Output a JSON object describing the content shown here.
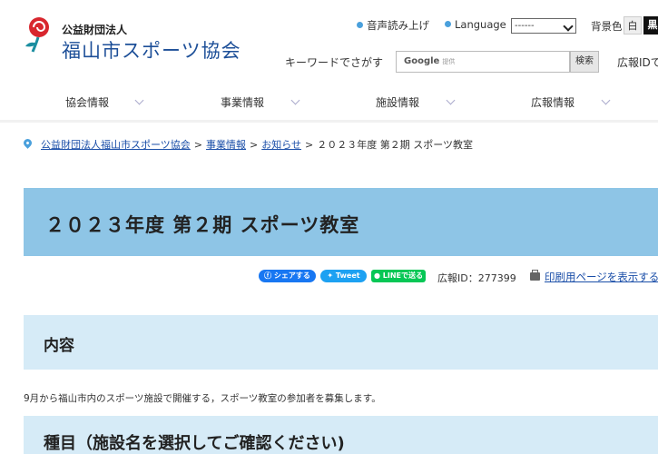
{
  "header": {
    "org_type": "公益財団法人",
    "org_name": "福山市スポーツ協会",
    "utility": {
      "read_aloud": "音声読み上げ",
      "language_label": "Language",
      "language_value": "------",
      "bg_color_label": "背景色",
      "bg_white": "白",
      "bg_black": "黒"
    },
    "search": {
      "label": "キーワードでさがす",
      "placeholder": "Google",
      "placeholder_sub": "提供",
      "button": "検索",
      "id_search_label": "広報IDで"
    }
  },
  "nav": {
    "items": [
      {
        "label": "協会情報"
      },
      {
        "label": "事業情報"
      },
      {
        "label": "施設情報"
      },
      {
        "label": "広報情報"
      }
    ]
  },
  "breadcrumb": {
    "links": [
      "公益財団法人福山市スポーツ協会",
      "事業情報",
      "お知らせ"
    ],
    "separator": ">",
    "current": "２０２３年度 第２期 スポーツ教室"
  },
  "page": {
    "title": "２０２３年度 第２期 スポーツ教室"
  },
  "share": {
    "facebook": "シェアする",
    "twitter": "Tweet",
    "line": "LINEで送る",
    "koho_id": "広報ID：277399",
    "print": "印刷用ページを表示する"
  },
  "content": {
    "section1_heading": "内容",
    "section1_text": "9月から福山市内のスポーツ施設で開催する，スポーツ教室の参加者を募集します。",
    "section2_heading": "種目（施設名を選択してご確認ください)"
  },
  "colors": {
    "accent_blue": "#8ec5e6",
    "light_blue": "#d6ebf7",
    "link": "#1a4ea8",
    "logo_red": "#d8262e",
    "logo_teal": "#1b8ea0"
  }
}
